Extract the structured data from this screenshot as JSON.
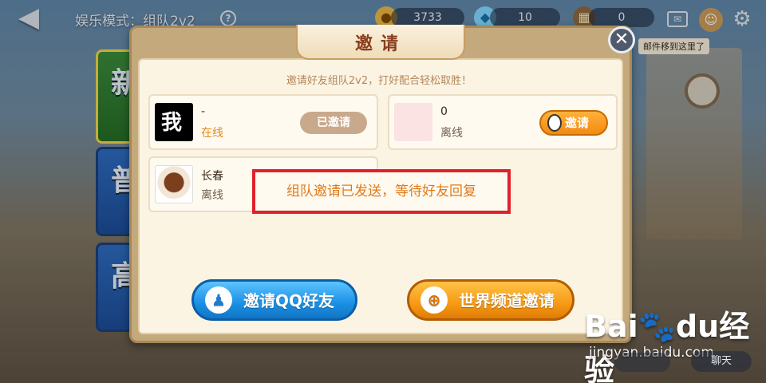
{
  "header": {
    "back_icon": "back-arrow-icon",
    "mode_title": "娱乐模式：组队2v2",
    "help_label": "?",
    "gold": "3733",
    "diamonds": "10",
    "tickets": "0",
    "mail_tip": "邮件移到这里了"
  },
  "background": {
    "tile_labels": [
      "新",
      "普",
      "高"
    ]
  },
  "modal": {
    "title": "邀请",
    "close_label": "✕",
    "subtitle": "邀请好友组队2v2，打好配合轻松取胜！",
    "friends": [
      {
        "name": "-",
        "status": "在线",
        "action": "已邀请",
        "avatar": "我"
      },
      {
        "name": "0",
        "status": "离线",
        "action": "邀请",
        "avatar": ""
      },
      {
        "name": "长春",
        "status": "离线",
        "action": "",
        "avatar": ""
      }
    ],
    "invite_qq_label": "邀请QQ好友",
    "world_channel_label": "世界频道邀请"
  },
  "toast": {
    "text": "组队邀请已发送，等待好友回复"
  },
  "watermark": {
    "logo": "Bai🐾du经验",
    "url": "jingyan.baidu.com"
  },
  "footer": {
    "chat_label": "聊天"
  },
  "colors": {
    "accent_orange": "#f38a10",
    "accent_blue": "#1a8fe4",
    "toast_border": "#e0212a",
    "online": "#e3881c"
  }
}
